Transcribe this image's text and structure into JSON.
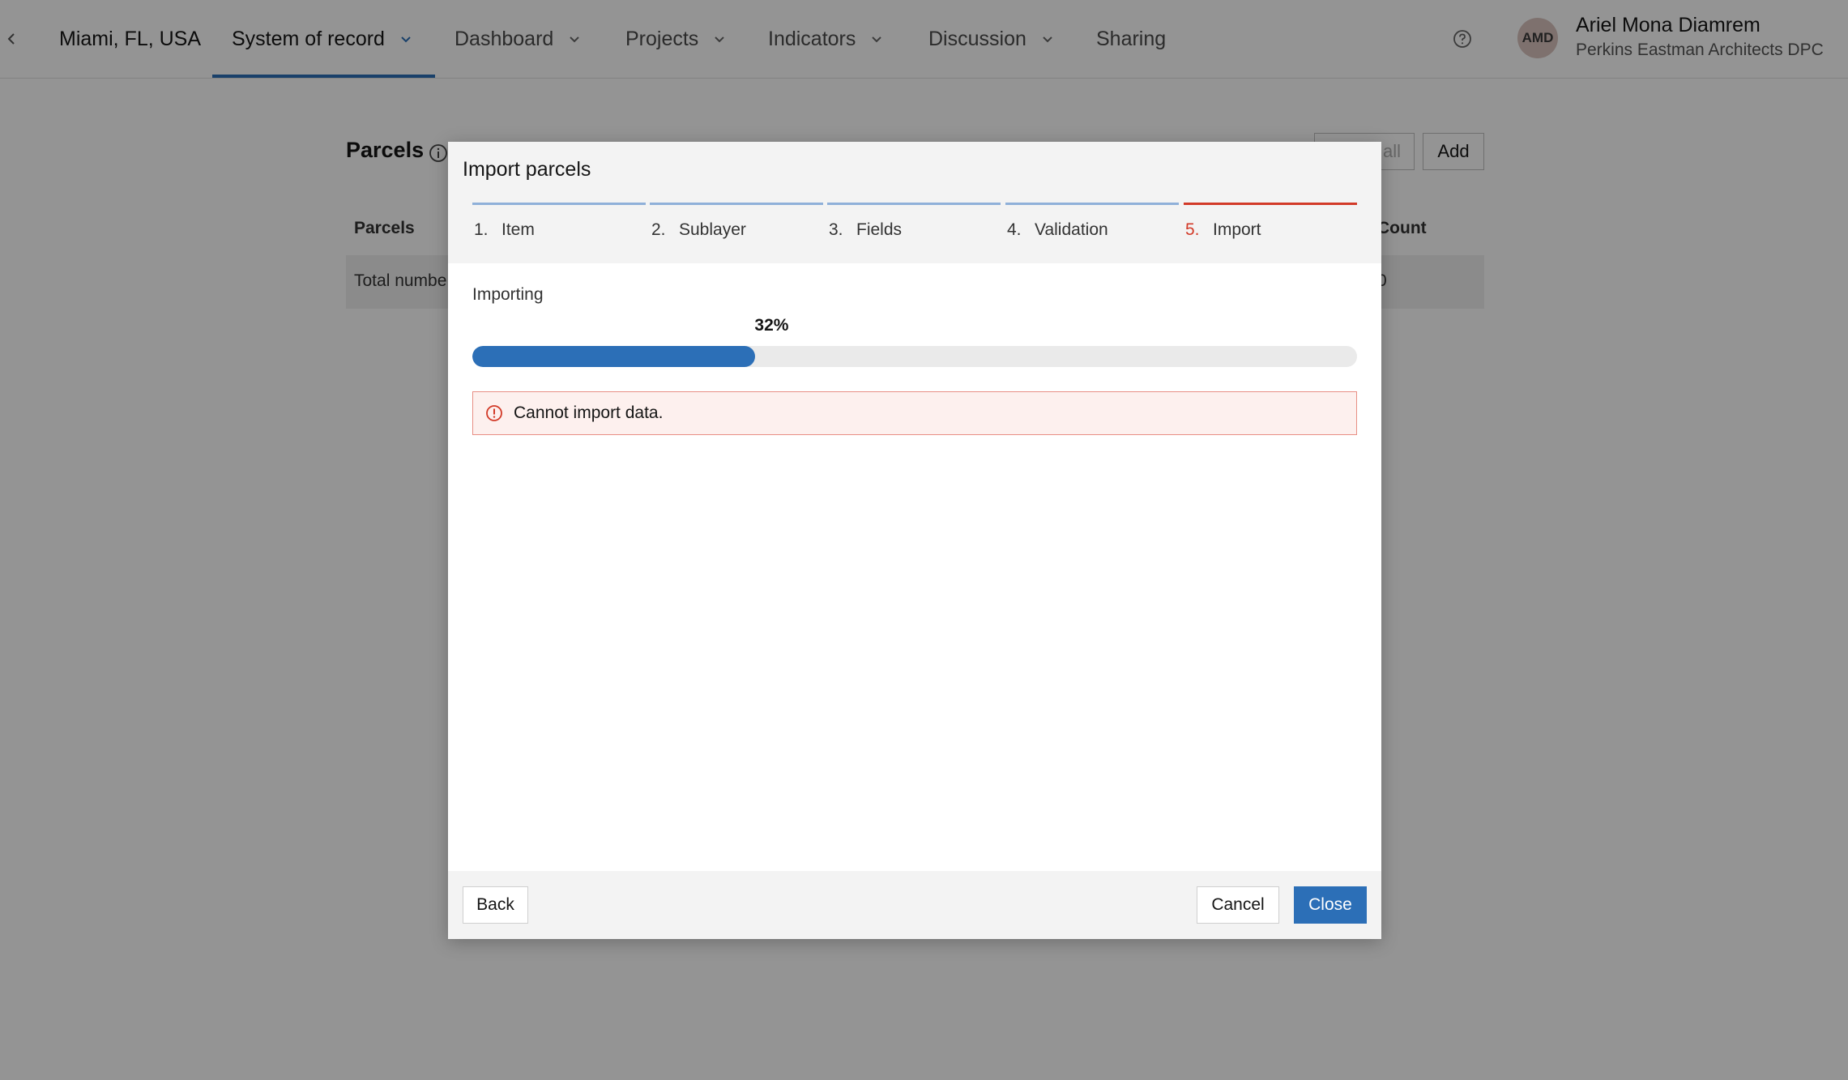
{
  "nav": {
    "context": "Miami, FL, USA",
    "items": [
      {
        "label": "System of record",
        "dropdown": true,
        "active": true
      },
      {
        "label": "Dashboard",
        "dropdown": true
      },
      {
        "label": "Projects",
        "dropdown": true
      },
      {
        "label": "Indicators",
        "dropdown": true
      },
      {
        "label": "Discussion",
        "dropdown": true
      },
      {
        "label": "Sharing",
        "dropdown": false
      }
    ],
    "help_icon": "question-circle-icon",
    "user": {
      "initials": "AMD",
      "name": "Ariel Mona Diamrem",
      "org": "Perkins Eastman Architects DPC"
    }
  },
  "page": {
    "title": "Parcels",
    "info_icon": "info-circle-icon",
    "delete_all_label": "all",
    "add_label": "Add",
    "table": {
      "headers": {
        "col1": "Parcels",
        "col2": "Count"
      },
      "row": {
        "col1": "Total numbe",
        "col2": "0"
      }
    }
  },
  "modal": {
    "title": "Import parcels",
    "steps": [
      {
        "num": "1.",
        "name": "Item"
      },
      {
        "num": "2.",
        "name": "Sublayer"
      },
      {
        "num": "3.",
        "name": "Fields"
      },
      {
        "num": "4.",
        "name": "Validation"
      },
      {
        "num": "5.",
        "name": "Import",
        "current": true
      }
    ],
    "importing_label": "Importing",
    "progress": {
      "percent": 32,
      "label": "32%"
    },
    "error": {
      "icon": "exclamation-circle-icon",
      "text": "Cannot import data."
    },
    "footer": {
      "back_label": "Back",
      "cancel_label": "Cancel",
      "close_label": "Close"
    }
  },
  "colors": {
    "accent": "#2c6fb7",
    "error": "#d23a28",
    "error_bg": "#fdf0ee"
  }
}
